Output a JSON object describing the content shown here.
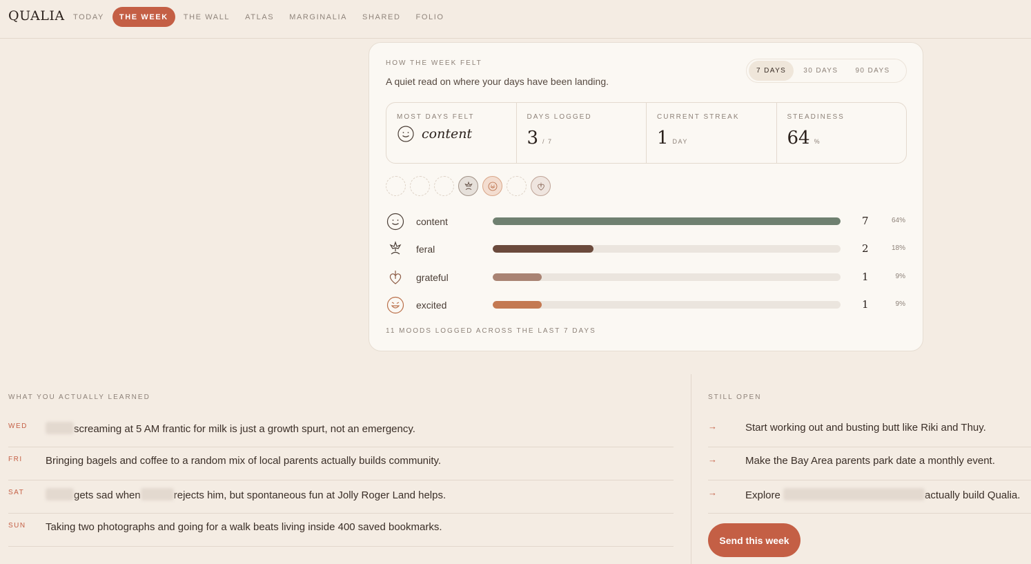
{
  "app": {
    "logo": "QUALIA"
  },
  "nav": [
    {
      "label": "TODAY",
      "active": false
    },
    {
      "label": "THE WEEK",
      "active": true
    },
    {
      "label": "THE WALL",
      "active": false
    },
    {
      "label": "ATLAS",
      "active": false
    },
    {
      "label": "MARGINALIA",
      "active": false
    },
    {
      "label": "SHARED",
      "active": false
    },
    {
      "label": "FOLIO",
      "active": false
    }
  ],
  "card": {
    "eyebrow": "HOW THE WEEK FELT",
    "subtitle": "A quiet read on where your days have been landing.",
    "ranges": [
      {
        "label": "7 DAYS",
        "active": true
      },
      {
        "label": "30 DAYS",
        "active": false
      },
      {
        "label": "90 DAYS",
        "active": false
      }
    ],
    "stats": {
      "most_days": {
        "label": "MOST DAYS FELT",
        "value": "content"
      },
      "days_logged": {
        "label": "DAYS LOGGED",
        "value": "3",
        "suffix": "/ 7"
      },
      "streak": {
        "label": "CURRENT STREAK",
        "value": "1",
        "suffix": "DAY"
      },
      "steadiness": {
        "label": "STEADINESS",
        "value": "64",
        "suffix": "%"
      }
    },
    "week_dots": [
      "",
      "",
      "",
      "feral",
      "excited",
      "",
      "grateful"
    ],
    "moods": [
      {
        "name": "content",
        "icon": "smiley-icon",
        "count": "7",
        "pct": "64%",
        "fraction": 1.0,
        "color": "#6f8070"
      },
      {
        "name": "feral",
        "icon": "feral-icon",
        "count": "2",
        "pct": "18%",
        "fraction": 0.29,
        "color": "#6b4a3c"
      },
      {
        "name": "grateful",
        "icon": "grateful-icon",
        "count": "1",
        "pct": "9%",
        "fraction": 0.14,
        "color": "#a98373"
      },
      {
        "name": "excited",
        "icon": "excited-icon",
        "count": "1",
        "pct": "9%",
        "fraction": 0.14,
        "color": "#c47952"
      }
    ],
    "footer": "11 MOODS LOGGED ACROSS THE LAST 7 DAYS"
  },
  "learned": {
    "eyebrow": "WHAT YOU ACTUALLY LEARNED",
    "items": [
      {
        "day": "WED",
        "pre": "",
        "mid": "screaming at 5 AM frantic for milk is just a growth spurt, not an emergency.",
        "post": ""
      },
      {
        "day": "FRI",
        "text": "Bringing bagels and coffee to a random mix of local parents actually builds community."
      },
      {
        "day": "SAT",
        "pre": "gets sad when",
        "post": "rejects him, but spontaneous fun at Jolly Roger Land helps."
      },
      {
        "day": "SUN",
        "text": "Taking two photographs and going for a walk beats living inside 400 saved bookmarks."
      }
    ]
  },
  "still_open": {
    "eyebrow": "STILL OPEN",
    "items": [
      {
        "text": "Start working out and busting butt like Riki and Thuy."
      },
      {
        "text": "Make the Bay Area parents park date a monthly event."
      },
      {
        "pre": "Explore",
        "post": "actually build Qualia."
      }
    ],
    "send_label": "Send this week"
  }
}
